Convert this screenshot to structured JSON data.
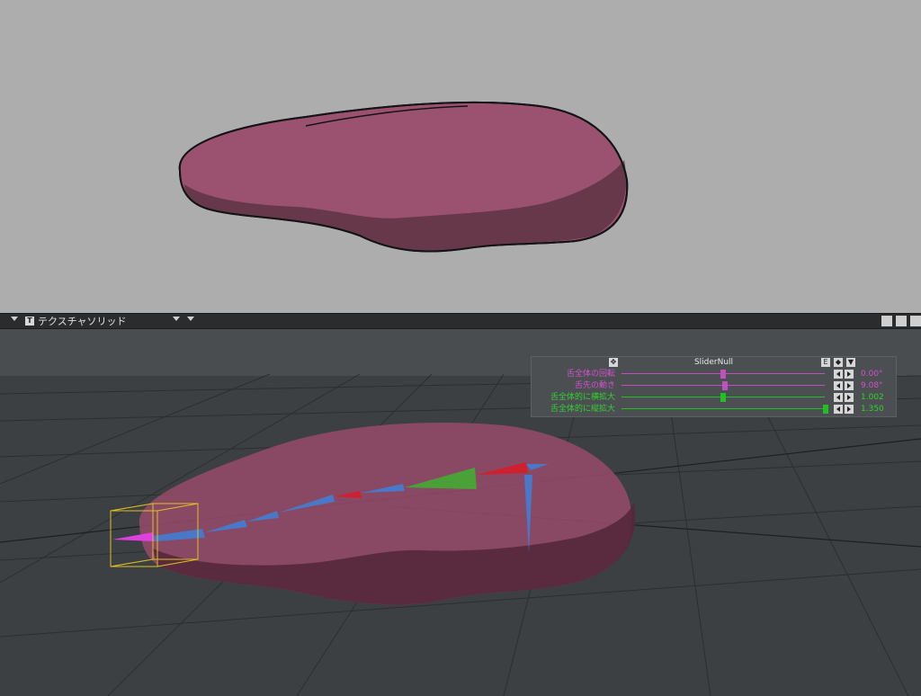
{
  "viewport_header": {
    "mode_icon_letter": "T",
    "mode_label": "テクスチャソリッド"
  },
  "slider_panel": {
    "title": "SliderNull",
    "e_button": "E",
    "rows": [
      {
        "label": "舌全体の回転",
        "value": "0.00°",
        "level": 0.5,
        "color": "#c050c0"
      },
      {
        "label": "舌先の動き",
        "value": "9.08°",
        "level": 0.52,
        "color": "#c050c0"
      },
      {
        "label": "舌全体的に横拡大",
        "value": "1.002",
        "level": 0.5,
        "color": "#20c020"
      },
      {
        "label": "舌全体的に縦拡大",
        "value": "1.350",
        "level": 1.0,
        "color": "#20c020"
      }
    ]
  },
  "colors": {
    "tongue": "#9b5270",
    "tongue_shadow": "#5e3243",
    "top_bg": "#adadad",
    "grid_bg": "#3d4043"
  }
}
